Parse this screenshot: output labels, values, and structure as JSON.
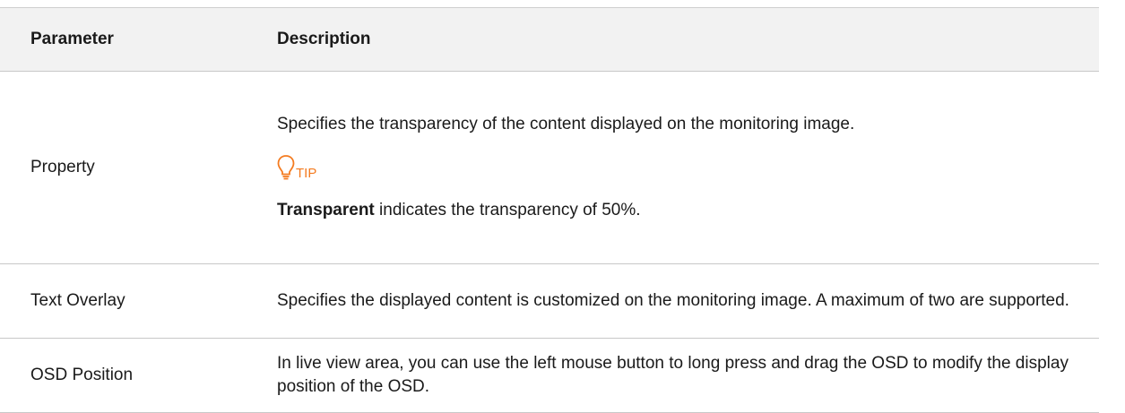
{
  "table": {
    "headers": {
      "parameter": "Parameter",
      "description": "Description"
    },
    "rows": [
      {
        "parameter": "Property",
        "description": "Specifies the transparency of the content displayed on the monitoring image.",
        "tip": {
          "icon": "lightbulb-icon",
          "label": "TIP",
          "color": "#F47B20",
          "bold_term": "Transparent",
          "text": " indicates the transparency of 50%."
        }
      },
      {
        "parameter": "Text Overlay",
        "description": "Specifies the displayed content is customized on the monitoring image. A maximum of two are supported."
      },
      {
        "parameter": "OSD Position",
        "description": "In live view area, you can use the left mouse button to long press and drag the OSD to modify the display position of the OSD."
      }
    ]
  }
}
